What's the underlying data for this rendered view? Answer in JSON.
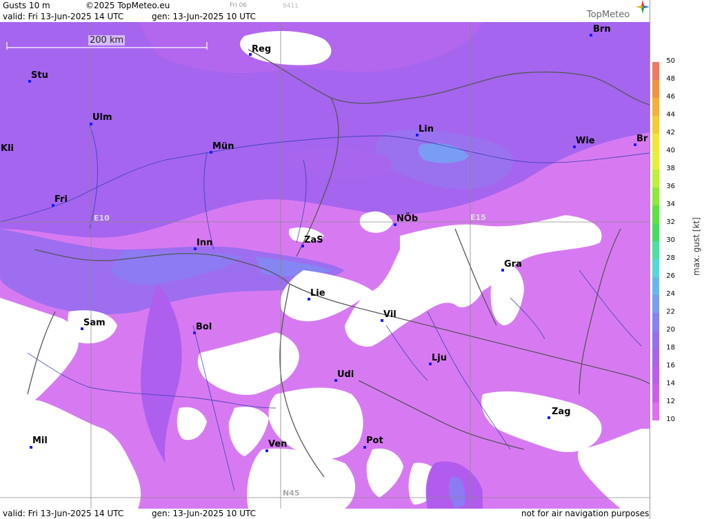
{
  "header": {
    "title": "Gusts 10 m",
    "copyright": "©2025 TopMeteo.eu",
    "run_tag": "Fri 06",
    "code": "9411",
    "valid": "valid:  Fri  13-Jun-2025  14 UTC",
    "gen": "gen: 13-Jun-2025 10 UTC"
  },
  "footer": {
    "valid": "valid:  Fri  13-Jun-2025  14 UTC",
    "gen": "gen: 13-Jun-2025 10 UTC",
    "disclaimer": "not for air navigation purposes"
  },
  "logo": {
    "text": "TopMeteo"
  },
  "scale_bar": {
    "label": "200 km"
  },
  "grid_labels": {
    "e10": "E10",
    "e15": "E15",
    "n45": "N45"
  },
  "legend": {
    "title": "max. gust [kt]",
    "ticks": [
      "50",
      "48",
      "46",
      "44",
      "42",
      "40",
      "38",
      "36",
      "34",
      "32",
      "30",
      "28",
      "26",
      "24",
      "22",
      "20",
      "18",
      "16",
      "14",
      "12",
      "10"
    ],
    "colors": [
      "#ef7a5e",
      "#f2933f",
      "#f4b03a",
      "#f5cc38",
      "#f4e53a",
      "#e6f03a",
      "#bdf03b",
      "#8fe83e",
      "#5fe044",
      "#48db62",
      "#4fdfa0",
      "#5ad6d9",
      "#6ab7ef",
      "#7b9cf3",
      "#8782f3",
      "#9470f0",
      "#a663ef",
      "#bb5ded",
      "#cc5eec",
      "#e06ef0"
    ]
  },
  "cities": [
    {
      "name": "Reg"
    },
    {
      "name": "Brn"
    },
    {
      "name": "Stu"
    },
    {
      "name": "Ulm"
    },
    {
      "name": "Lin"
    },
    {
      "name": "Wie"
    },
    {
      "name": "Br"
    },
    {
      "name": "Kli"
    },
    {
      "name": "Mün"
    },
    {
      "name": "Fri"
    },
    {
      "name": "NÖb"
    },
    {
      "name": "Inn"
    },
    {
      "name": "ZaS"
    },
    {
      "name": "Gra"
    },
    {
      "name": "Lie"
    },
    {
      "name": "Sam"
    },
    {
      "name": "Vil"
    },
    {
      "name": "Bol"
    },
    {
      "name": "Lju"
    },
    {
      "name": "Udi"
    },
    {
      "name": "Zag"
    },
    {
      "name": "Mil"
    },
    {
      "name": "Ven"
    },
    {
      "name": "Pot"
    }
  ]
}
